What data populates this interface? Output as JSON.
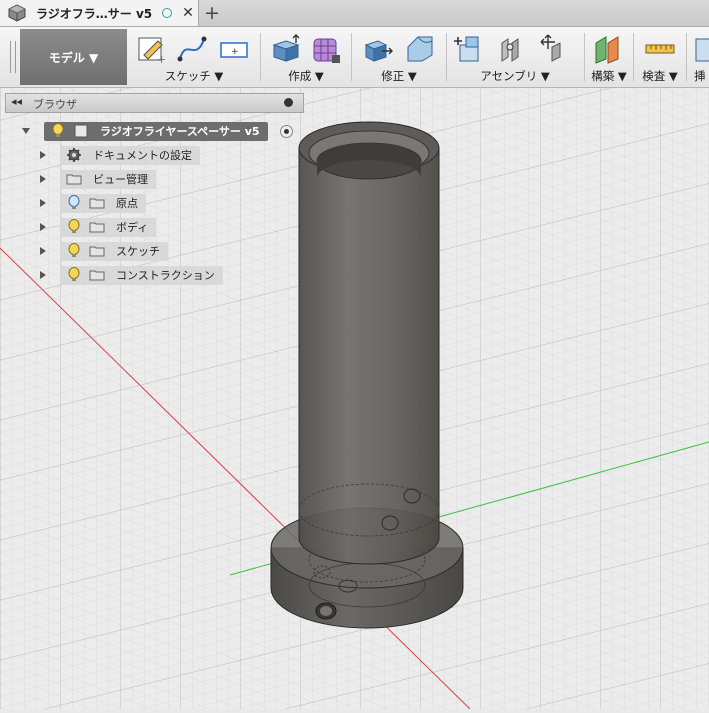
{
  "tab": {
    "title": "ラジオフラ…サー v5",
    "close": "✕",
    "new": "+"
  },
  "toolbar": {
    "mode": "モデル ▼",
    "groups": [
      {
        "label": "スケッチ ▼"
      },
      {
        "label": "作成 ▼"
      },
      {
        "label": "修正 ▼"
      },
      {
        "label": "アセンブリ ▼"
      },
      {
        "label": "構築 ▼"
      },
      {
        "label": "検査 ▼"
      },
      {
        "label": "挿"
      }
    ]
  },
  "browser": {
    "title": "ブラウザ",
    "collapse": "◂◂",
    "root": "ラジオフライヤースペーサー v5",
    "items": [
      {
        "label": "ドキュメントの設定"
      },
      {
        "label": "ビュー管理"
      },
      {
        "label": "原点"
      },
      {
        "label": "ボディ"
      },
      {
        "label": "スケッチ"
      },
      {
        "label": "コンストラクション"
      }
    ]
  },
  "colors": {
    "body": "#5c5a56",
    "accent_red": "#e04040",
    "accent_green": "#3fbf3f"
  }
}
